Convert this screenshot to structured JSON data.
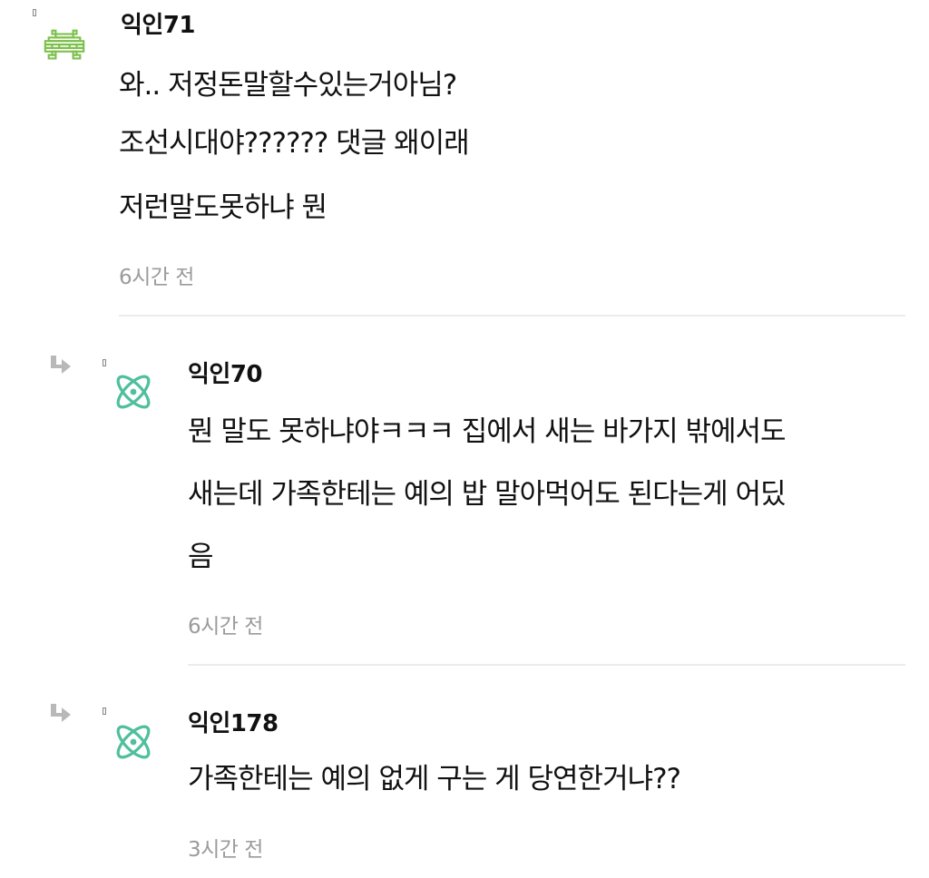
{
  "comments": [
    {
      "nickname": "익인71",
      "lines": [
        "와.. 저정돈말할수있는거아님?",
        "조선시대야?????? 댓글 왜이래",
        "저런말도못하냐 뭔"
      ],
      "time": "6시간 전",
      "avatar_icon": "pixel-invader-icon",
      "avatar_color": "#7cc04a"
    },
    {
      "nickname": "익인70",
      "lines": [
        "뭔 말도 못하냐야ㅋㅋㅋ 집에서 새는 바가지 밖에서도",
        "새는데 가족한테는 예의 밥 말아먹어도 된다는게 어딨",
        "음"
      ],
      "time": "6시간 전",
      "avatar_icon": "atom-icon",
      "avatar_color": "#4fbf9d",
      "reply_icon": "reply-arrow-icon"
    },
    {
      "nickname": "익인178",
      "lines": [
        "가족한테는 예의 없게 구는 게 당연한거냐??"
      ],
      "time": "3시간 전",
      "avatar_icon": "atom-icon",
      "avatar_color": "#4fbf9d",
      "reply_icon": "reply-arrow-icon"
    }
  ]
}
